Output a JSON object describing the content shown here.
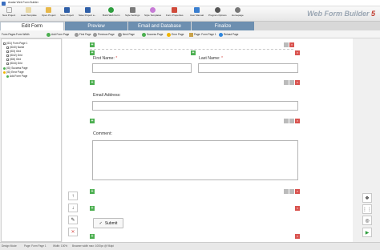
{
  "window": {
    "title": "Avatar Web Form Builder"
  },
  "toolbar": {
    "items": [
      "New Project",
      "Load Template",
      "Open Project",
      "Save Project",
      "Save Project a...",
      "Build Web Form",
      "Style Settings",
      "Style Templates",
      "Form Properties",
      "User Manual",
      "Program Options",
      "Homepage"
    ],
    "brand": "Web Form Builder",
    "brand_num": "5"
  },
  "tabs": [
    "Edit Form",
    "Preview",
    "Email and Database",
    "Finalize"
  ],
  "subtoolbar": [
    "Form Pages",
    "Form Width",
    "Add Form Page",
    "First Page",
    "Previous Page",
    "Next Page",
    "Success Page",
    "Error Page",
    "Page: Form Page 1",
    "Reload Page"
  ],
  "tree": [
    {
      "label": "(ID1) Form Page 1",
      "level": 0
    },
    {
      "label": "(ID40) Name",
      "level": 1
    },
    {
      "label": "(ID3) Grid",
      "level": 1
    },
    {
      "label": "(ID42) Grid",
      "level": 1
    },
    {
      "label": "(ID6) Grid",
      "level": 1
    },
    {
      "label": "(ID44) Grid",
      "level": 1
    },
    {
      "label": "(ID) Success Page",
      "level": 0
    },
    {
      "label": "(ID) Error Page",
      "level": 0
    },
    {
      "label": "Add Form Page",
      "level": 1
    }
  ],
  "form": {
    "first_name": "First Name:",
    "last_name": "Last Name:",
    "required_mark": "*",
    "email": "Email Address:",
    "comment": "Comment:",
    "submit": "Submit"
  },
  "status": [
    "Design Mode",
    "Page: Form Page 1",
    "Width: 100%",
    "Browser width max: 1000px @ 96dpi"
  ],
  "colors": {
    "tab_active_bg": "#ffffff",
    "tab_bg": "#6d8fb0",
    "plus": "#4caf50",
    "delete": "#d9534f"
  }
}
